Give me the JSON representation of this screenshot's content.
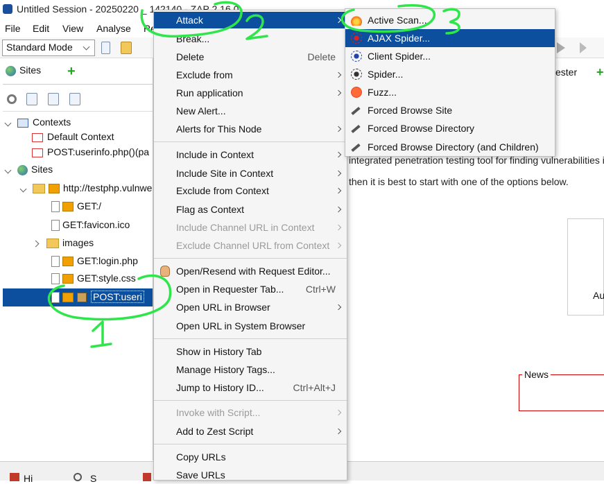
{
  "window": {
    "title": "Untitled Session - 20250220 _ 142140 - ZAP 2.16.0"
  },
  "menubar": {
    "file": "File",
    "edit": "Edit",
    "view": "View",
    "analyse": "Analyse",
    "report": "Re"
  },
  "toolbar": {
    "mode": "Standard Mode"
  },
  "sites_tab": {
    "label": "Sites"
  },
  "tree": {
    "contexts": "Contexts",
    "default_context": "Default Context",
    "post_context": "POST:userinfo.php()(pa",
    "sites": "Sites",
    "host": "http://testphp.vulnwe",
    "n1": "GET:/",
    "n2": "GET:favicon.ico",
    "n3": "images",
    "n4": "GET:login.php",
    "n5": "GET:style.css",
    "n6": "POST:useri"
  },
  "context_menu": {
    "attack": "Attack",
    "break": "Break...",
    "delete": "Delete",
    "delete_acc": "Delete",
    "exclude_from": "Exclude from",
    "run_application": "Run application",
    "new_alert": "New Alert...",
    "alerts_for_node": "Alerts for This Node",
    "include_in_context": "Include in Context",
    "include_site_in_context": "Include Site in Context",
    "exclude_from_context": "Exclude from Context",
    "flag_as_context": "Flag as Context",
    "include_channel_url": "Include Channel URL in Context",
    "exclude_channel_url": "Exclude Channel URL from Context",
    "open_resend": "Open/Resend with Request Editor...",
    "open_requester": "Open in Requester Tab...",
    "open_requester_acc": "Ctrl+W",
    "open_url_browser": "Open URL in Browser",
    "open_url_system": "Open URL in System Browser",
    "show_history": "Show in History Tab",
    "manage_tags": "Manage History Tags...",
    "jump_history": "Jump to History ID...",
    "jump_history_acc": "Ctrl+Alt+J",
    "invoke_script": "Invoke with Script...",
    "add_zest": "Add to Zest Script",
    "copy_urls": "Copy URLs",
    "save_urls": "Save URLs"
  },
  "attack_submenu": {
    "active_scan": "Active Scan...",
    "ajax_spider": "AJAX Spider...",
    "client_spider": "Client Spider...",
    "spider": "Spider...",
    "fuzz": "Fuzz...",
    "forced_site": "Forced Browse Site",
    "forced_dir": "Forced Browse Directory",
    "forced_dir_children": "Forced Browse Directory (and Children)"
  },
  "background": {
    "line1": "integrated penetration testing tool for finding vulnerabilities i",
    "line2": "then it is best to start with one of the options below.",
    "requester": "ester",
    "au": "Au",
    "news": "News"
  },
  "annotations": {
    "a1": "1",
    "a2": "2",
    "a3": "3"
  },
  "bottom": {
    "history": "Hi",
    "search": "S"
  },
  "colors": {
    "selection": "#0b4f9e",
    "annotation": "#2ee64a",
    "news_border": "#cc0000"
  }
}
